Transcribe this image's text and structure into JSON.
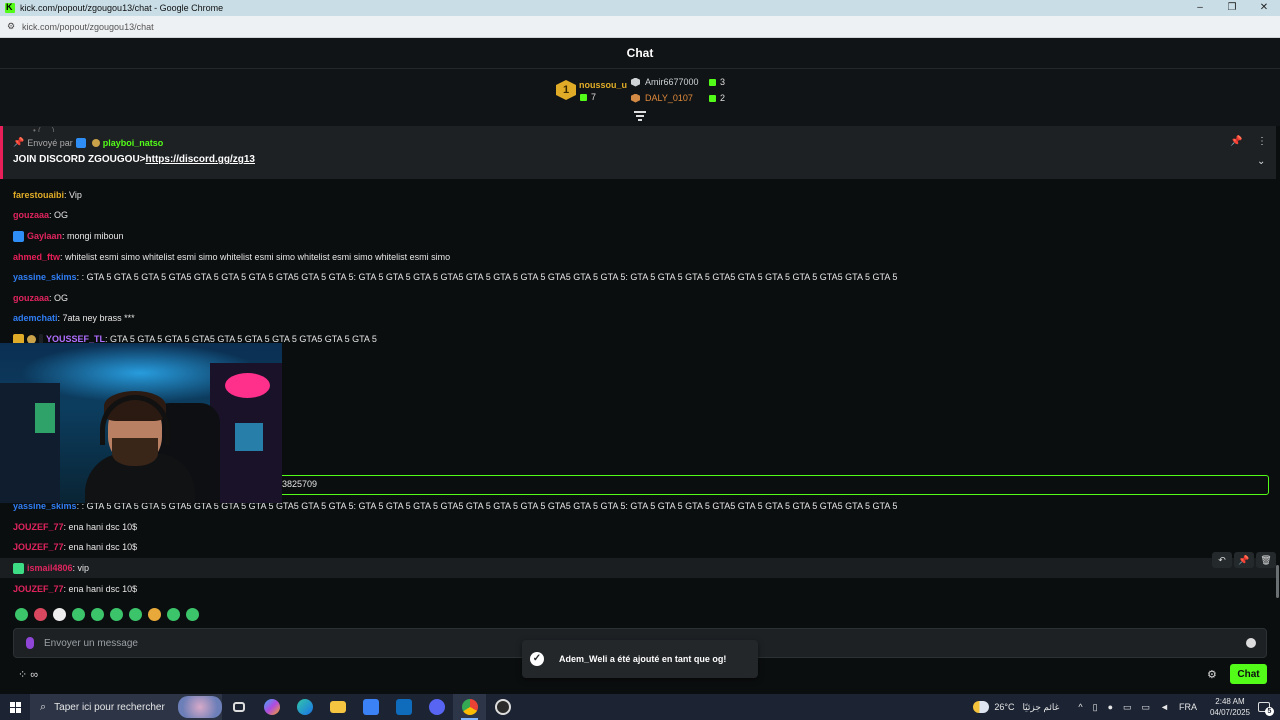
{
  "window": {
    "title": "kick.com/popout/zgougou13/chat - Google Chrome",
    "url": "kick.com/popout/zgougou13/chat",
    "controls": {
      "minimize": "–",
      "restore": "❐",
      "close": "✕"
    }
  },
  "chat": {
    "title": "Chat",
    "leaderboard": {
      "first": {
        "rank": "1",
        "name": "noussou_u",
        "count": "7"
      },
      "second": {
        "name": "Amir6677000",
        "count": "3"
      },
      "third": {
        "name": "DALY_0107",
        "count": "2"
      }
    },
    "pinned": {
      "ghost_text": "• ( ... ) ... ... ...",
      "sent_by_label": "Envoyé par",
      "sender": "playboi_natso",
      "text": "JOIN DISCORD ZGOUGOU>",
      "link": "https://discord.gg/zg13"
    },
    "messages": [
      {
        "user": "farestouaibi",
        "color": "#e0ac27",
        "text": ": Vip"
      },
      {
        "user": "gouzaaa",
        "color": "#e0245e",
        "text": ": OG"
      },
      {
        "user": "Gaylaan",
        "color": "#e0245e",
        "text": ": mongi miboun"
      },
      {
        "user": "ahmed_ftw",
        "color": "#e91f59",
        "text": ": whitelist esmi simo whitelist esmi simo whitelist esmi simo whitelist esmi simo whitelist esmi simo"
      },
      {
        "user": "yassine_skims",
        "color": "#2f7ef5",
        "text": ": : GTA 5 GTA 5 GTA 5 GTA5 GTA 5 GTA 5 GTA 5 GTA5 GTA 5 GTA 5: GTA 5 GTA 5 GTA 5 GTA5 GTA 5 GTA 5 GTA 5 GTA5 GTA 5 GTA 5: GTA 5 GTA 5 GTA 5 GTA5 GTA 5 GTA 5 GTA 5 GTA5 GTA 5 GTA 5"
      },
      {
        "user": "gouzaaa",
        "color": "#e0245e",
        "text": ": OG"
      },
      {
        "user": "ademchati",
        "color": "#2f7ef5",
        "text": ": 7ata ney brass ***"
      },
      {
        "user": "YOUSSEF_TL",
        "color": "#b06fff",
        "text": ": GTA 5 GTA 5 GTA 5 GTA5 GTA 5 GTA 5 GTA 5 GTA5 GTA 5 GTA 5"
      },
      {
        "user": "yassine_skims",
        "color": "#2f7ef5",
        "text": ": : GTA 5 GTA 5 GTA 5 GTA5 GTA 5 GTA 5 GTA 5 GTA5 GTA 5 GTA 5: GTA 5 GTA 5 GTA 5 GTA5 GTA 5 GTA 5 GTA 5 GTA5 GTA 5 GTA 5: GTA 5 GTA 5 GTA 5 GTA5 GTA 5 GTA 5 GTA 5 GTA5 GTA 5 GTA 5"
      },
      {
        "user": "JOUZEF_77",
        "color": "#e0245e",
        "text": ": ena hani dsc 10$"
      },
      {
        "user": "JOUZEF_77",
        "color": "#e0245e",
        "text": ": ena hani dsc 10$"
      },
      {
        "user": "ismail4806",
        "color": "#e0245e",
        "text": ": vip"
      },
      {
        "user": "JOUZEF_77",
        "color": "#e0245e",
        "text": ": ena hani dsc 10$"
      }
    ],
    "highlighted_fragment": "3825709",
    "input_placeholder": "Envoyer un message",
    "toast": "Adem_Weli a été ajouté en tant que og!",
    "footer_left": "∞",
    "chat_button": "Chat"
  },
  "taskbar": {
    "search_placeholder": "Taper ici pour rechercher",
    "temperature": "26°C",
    "weather_text": "غائم جزئيًا",
    "language": "FRA",
    "time": "2:48 AM",
    "date": "04/07/2025",
    "notifications": "5"
  }
}
